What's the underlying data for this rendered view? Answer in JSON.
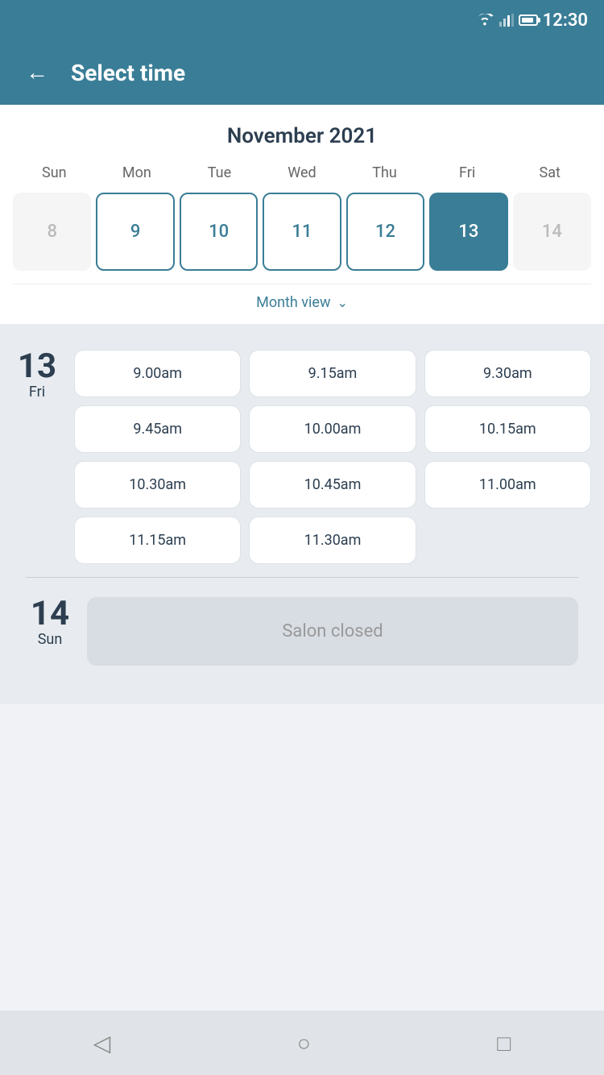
{
  "statusBar": {
    "time": "12:30"
  },
  "header": {
    "back_label": "←",
    "title": "Select time"
  },
  "calendar": {
    "month_year": "November 2021",
    "weekdays": [
      "Sun",
      "Mon",
      "Tue",
      "Wed",
      "Thu",
      "Fri",
      "Sat"
    ],
    "days": [
      {
        "number": "8",
        "state": "inactive"
      },
      {
        "number": "9",
        "state": "active"
      },
      {
        "number": "10",
        "state": "active"
      },
      {
        "number": "11",
        "state": "active"
      },
      {
        "number": "12",
        "state": "active"
      },
      {
        "number": "13",
        "state": "selected"
      },
      {
        "number": "14",
        "state": "inactive"
      }
    ],
    "month_view_label": "Month view"
  },
  "schedule": [
    {
      "day_number": "13",
      "day_name": "Fri",
      "time_slots": [
        "9.00am",
        "9.15am",
        "9.30am",
        "9.45am",
        "10.00am",
        "10.15am",
        "10.30am",
        "10.45am",
        "11.00am",
        "11.15am",
        "11.30am"
      ]
    }
  ],
  "closed_day": {
    "day_number": "14",
    "day_name": "Sun",
    "message": "Salon closed"
  },
  "nav": {
    "back_icon": "◁",
    "home_icon": "○",
    "apps_icon": "□"
  }
}
